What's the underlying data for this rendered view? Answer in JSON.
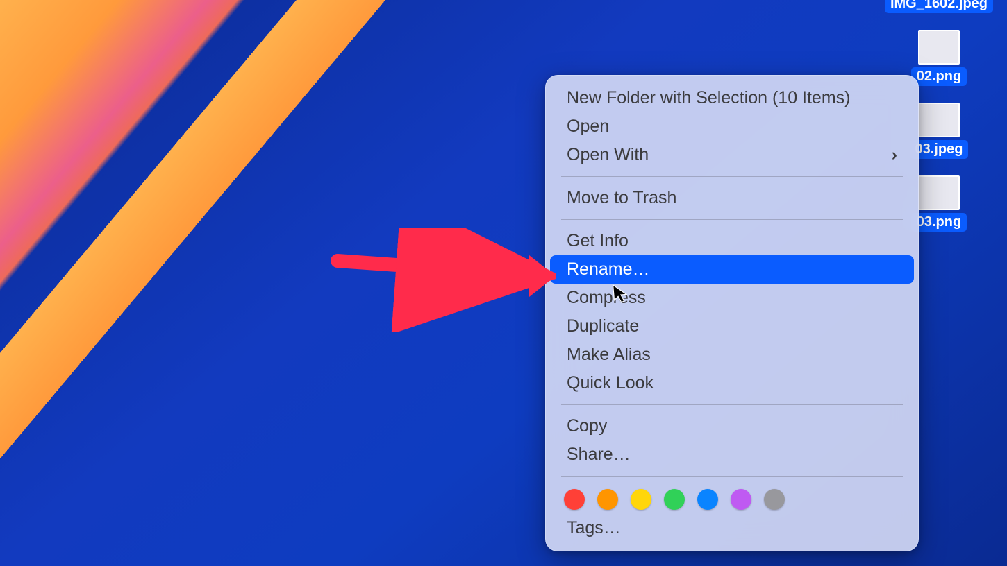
{
  "desktop_files": [
    {
      "label": "IMG_1602.jpeg",
      "thumb_only_label": true
    },
    {
      "label": "02.png"
    },
    {
      "label": "03.jpeg"
    },
    {
      "label": "03.png"
    }
  ],
  "context_menu": {
    "groups": [
      [
        {
          "label": "New Folder with Selection (10 Items)",
          "submenu": false
        },
        {
          "label": "Open",
          "submenu": false
        },
        {
          "label": "Open With",
          "submenu": true
        }
      ],
      [
        {
          "label": "Move to Trash",
          "submenu": false
        }
      ],
      [
        {
          "label": "Get Info",
          "submenu": false
        },
        {
          "label": "Rename…",
          "submenu": false,
          "highlighted": true
        },
        {
          "label": "Compress",
          "submenu": false
        },
        {
          "label": "Duplicate",
          "submenu": false
        },
        {
          "label": "Make Alias",
          "submenu": false
        },
        {
          "label": "Quick Look",
          "submenu": false
        }
      ],
      [
        {
          "label": "Copy",
          "submenu": false
        },
        {
          "label": "Share…",
          "submenu": false
        }
      ]
    ],
    "tags_colors": [
      "#ff4037",
      "#ff9500",
      "#ffd60a",
      "#30d158",
      "#0a84ff",
      "#bf5af2",
      "#98989d"
    ],
    "tags_label": "Tags…"
  },
  "annotation": {
    "arrow_color": "#ff2b4b"
  }
}
